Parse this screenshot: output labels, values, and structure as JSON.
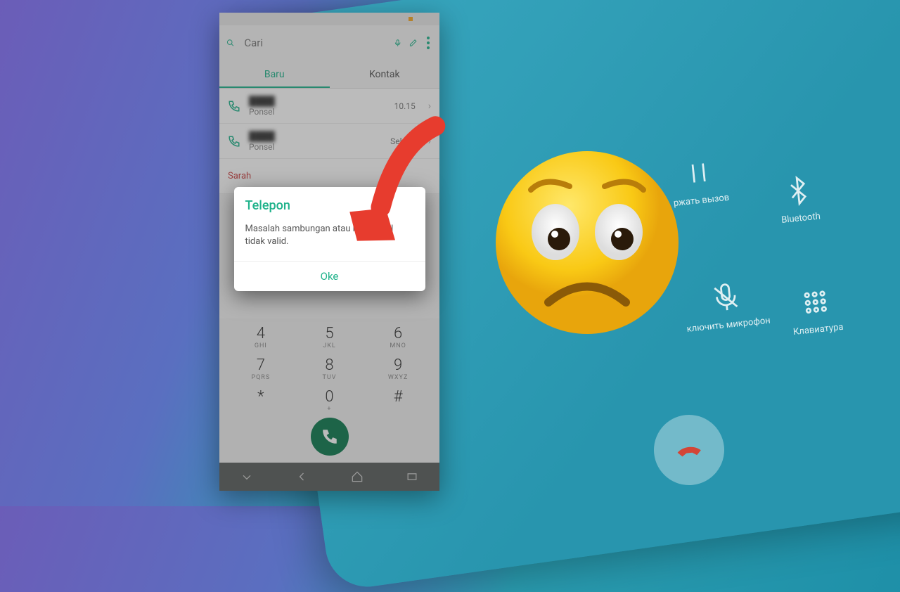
{
  "search": {
    "placeholder": "Cari"
  },
  "tabs": {
    "recent": "Baru",
    "contacts": "Kontak"
  },
  "log": [
    {
      "name": "████",
      "sub": "Ponsel",
      "time": "10.15"
    },
    {
      "name": "████",
      "sub": "Ponsel",
      "time": "Selasa"
    },
    {
      "name": "Sarah",
      "sub": "",
      "time": ""
    }
  ],
  "dialpad": {
    "keys": [
      {
        "n": "4",
        "l": "GHI"
      },
      {
        "n": "5",
        "l": "JKL"
      },
      {
        "n": "6",
        "l": "MNO"
      },
      {
        "n": "7",
        "l": "PQRS"
      },
      {
        "n": "8",
        "l": "TUV"
      },
      {
        "n": "9",
        "l": "WXYZ"
      },
      {
        "n": "*",
        "l": ""
      },
      {
        "n": "0",
        "l": "+"
      },
      {
        "n": "#",
        "l": ""
      }
    ]
  },
  "dialog": {
    "title": "Telepon",
    "message": "Masalah sambungan atau kode MMI tidak valid.",
    "ok": "Oke"
  },
  "bg_call": {
    "hold": "ржать вызов",
    "bt": "Bluetooth",
    "mic": "ключить микрофон",
    "keypad": "Клавиатура"
  }
}
